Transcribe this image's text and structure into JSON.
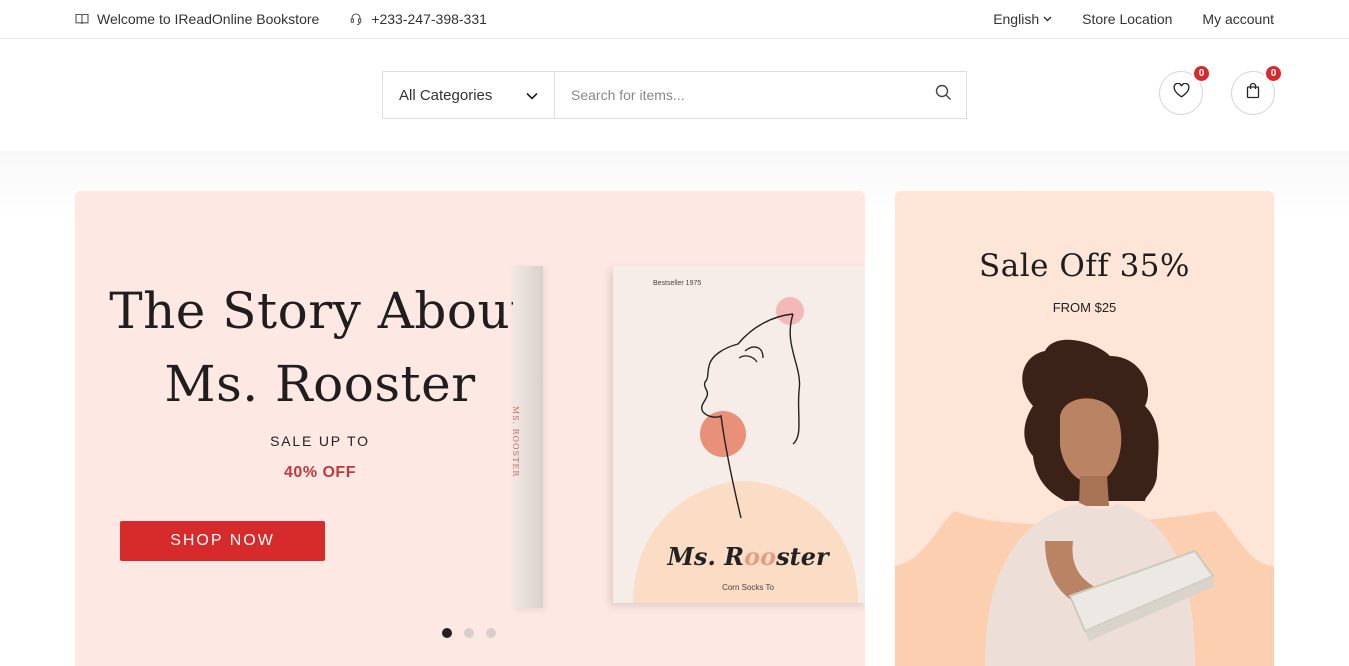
{
  "topbar": {
    "welcome": "Welcome to IReadOnline Bookstore",
    "phone": "+233-247-398-331",
    "language": "English",
    "store_location": "Store Location",
    "my_account": "My account"
  },
  "header": {
    "category_select": "All Categories",
    "search_placeholder": "Search for items...",
    "wishlist_count": "0",
    "cart_count": "0"
  },
  "hero": {
    "title_line1": "The Story About",
    "title_line2": "Ms. Rooster",
    "sale_label": "SALE UP TO",
    "sale_value": "40% OFF",
    "cta": "SHOP NOW",
    "book": {
      "spine_text": "MS. ROOSTER",
      "cover_top": "Bestseller 1975",
      "cover_title_a": "Ms. R",
      "cover_title_oo": "oo",
      "cover_title_b": "ster",
      "cover_subtitle": "Corn Socks To"
    },
    "slides": 3,
    "active_slide": 1
  },
  "promo": {
    "title": "Sale Off 35%",
    "subtitle": "FROM $25"
  },
  "colors": {
    "accent": "#d72a2a",
    "hero_bg": "#fde8e3",
    "promo_bg": "#fde6d8",
    "sale_text": "#c0393b"
  }
}
